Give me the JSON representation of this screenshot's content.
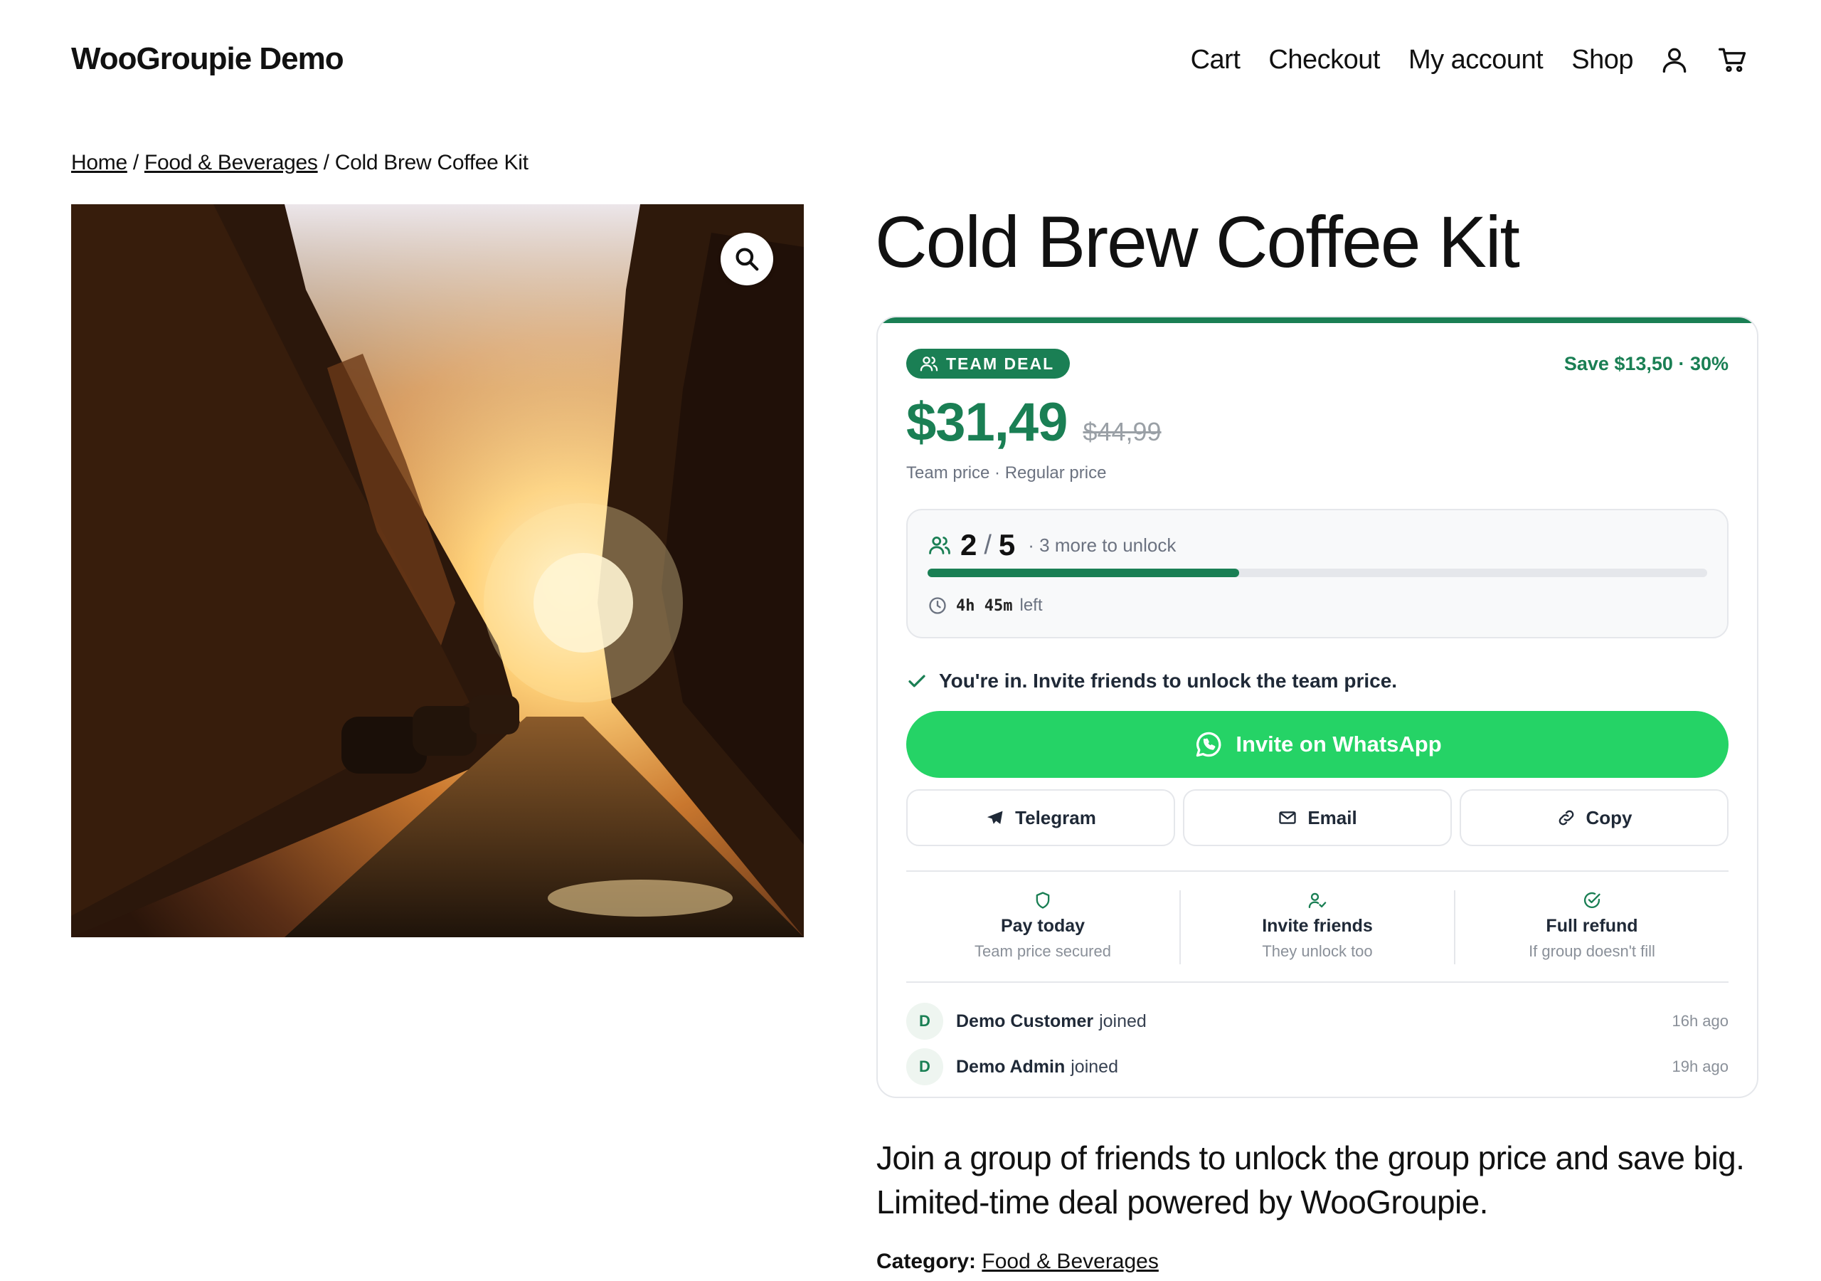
{
  "site": {
    "title": "WooGroupie Demo"
  },
  "nav": {
    "cart": "Cart",
    "checkout": "Checkout",
    "account": "My account",
    "shop": "Shop"
  },
  "breadcrumb": {
    "home": "Home",
    "sep1": " / ",
    "category": "Food & Beverages",
    "sep2": " / ",
    "current": "Cold Brew Coffee Kit"
  },
  "product": {
    "title": "Cold Brew Coffee Kit",
    "description": "Join a group of friends to unlock the group price and save big. Limited-time deal powered by WooGroupie.",
    "category_label": "Category:",
    "category": "Food & Beverages"
  },
  "deal": {
    "badge": "TEAM DEAL",
    "save": "Save $13,50 · 30%",
    "price_current": "$31,49",
    "price_regular": "$44,99",
    "price_labels": "Team price · Regular price",
    "joined_count": "2",
    "count_sep": "/",
    "group_size": "5",
    "more_to_unlock": "· 3 more to unlock",
    "progress_fraction": 0.4,
    "timer": "4h 45m",
    "timer_suffix": "left",
    "status_msg": "You're in. Invite friends to unlock the team price.",
    "whatsapp_label": "Invite on WhatsApp",
    "telegram_label": "Telegram",
    "email_label": "Email",
    "copy_label": "Copy"
  },
  "features": [
    {
      "title": "Pay today",
      "sub": "Team price secured",
      "icon": "shield-icon"
    },
    {
      "title": "Invite friends",
      "sub": "They unlock too",
      "icon": "user-check-icon"
    },
    {
      "title": "Full refund",
      "sub": "If group doesn't fill",
      "icon": "check-circle-icon"
    }
  ],
  "members": [
    {
      "initial": "D",
      "name": "Demo Customer",
      "action": "joined",
      "time": "16h ago"
    },
    {
      "initial": "D",
      "name": "Demo Admin",
      "action": "joined",
      "time": "19h ago"
    }
  ],
  "colors": {
    "accent": "#1a7f54",
    "whatsapp": "#25d366",
    "border": "#e5e7eb",
    "muted": "#6b7280"
  }
}
